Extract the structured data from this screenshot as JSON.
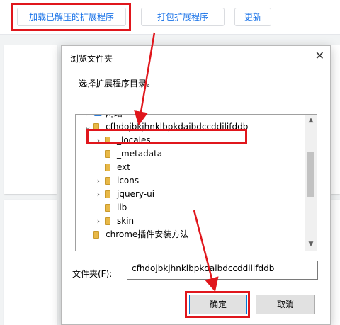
{
  "toolbar": {
    "load_unpacked": "加载已解压的扩展程序",
    "pack": "打包扩展程序",
    "update": "更新"
  },
  "dialog": {
    "title": "浏览文件夹",
    "close_glyph": "✕",
    "prompt": "选择扩展程序目录。",
    "tree": [
      {
        "label": "网络",
        "chevron": "›",
        "icon": "network-icon"
      },
      {
        "label": "cfhdojbkjhnklbpkdaibdccddilifddb",
        "chevron": "⌄",
        "icon": "folder-icon",
        "selected": true
      },
      {
        "label": "_locales",
        "chevron": "›",
        "icon": "folder-icon"
      },
      {
        "label": "_metadata",
        "chevron": "",
        "icon": "folder-icon"
      },
      {
        "label": "ext",
        "chevron": "",
        "icon": "folder-icon"
      },
      {
        "label": "icons",
        "chevron": "›",
        "icon": "folder-icon"
      },
      {
        "label": "jquery-ui",
        "chevron": "›",
        "icon": "folder-icon"
      },
      {
        "label": "lib",
        "chevron": "",
        "icon": "folder-icon"
      },
      {
        "label": "skin",
        "chevron": "›",
        "icon": "folder-icon"
      },
      {
        "label": "chrome插件安装方法",
        "chevron": "",
        "icon": "folder-icon"
      }
    ],
    "scroll_up": "▲",
    "scroll_down": "▼",
    "folder_field_label": "文件夹(F):",
    "folder_field_value": "cfhdojbkjhnklbpkdaibdccddilifddb",
    "ok": "确定",
    "cancel": "取消"
  },
  "colors": {
    "annotation": "#e0161c",
    "link_blue": "#1a73e8",
    "folder": "#e8b847"
  }
}
